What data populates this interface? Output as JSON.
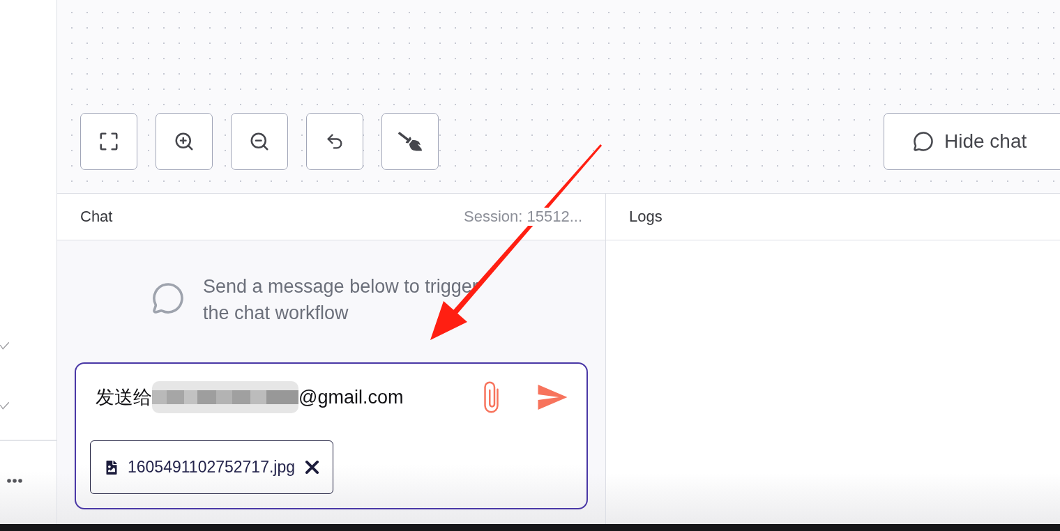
{
  "hide_chat_button": {
    "label": "Hide chat"
  },
  "chat_panel": {
    "title": "Chat",
    "session": "Session: 15512...",
    "empty_state": {
      "message": "Send a message below to trigger the chat workflow"
    },
    "message_input": {
      "value_start": "发送给",
      "redacted": true,
      "value_end": "@gmail.com"
    },
    "attachments": [
      {
        "file_name": "1605491102752717.jpg"
      }
    ]
  },
  "logs_panel": {
    "title": "Logs"
  }
}
